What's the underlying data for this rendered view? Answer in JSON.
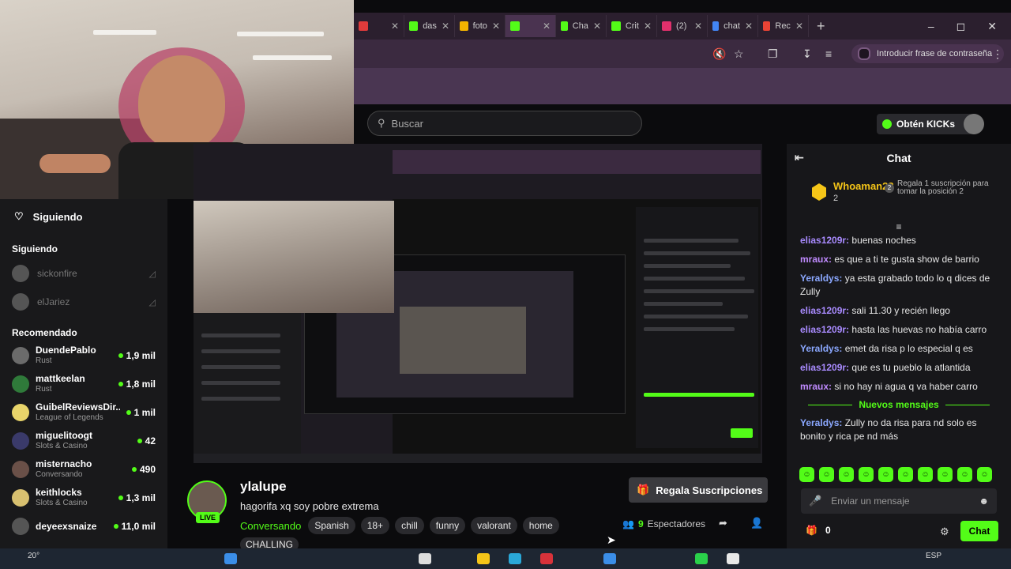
{
  "browser": {
    "tabs": [
      {
        "label": "",
        "color": "#e03b3b"
      },
      {
        "label": "das",
        "color": "#53fc18"
      },
      {
        "label": "foto",
        "color": "#f4b400"
      },
      {
        "label": "",
        "color": "#53fc18",
        "active": true
      },
      {
        "label": "Cha",
        "color": "#53fc18"
      },
      {
        "label": "Crit",
        "color": "#53fc18"
      },
      {
        "label": "(2)",
        "color": "#e1306c"
      },
      {
        "label": "chat",
        "color": "#4285f4"
      },
      {
        "label": "Rec",
        "color": "#ea4335"
      }
    ],
    "new_tab": "+",
    "password_pill": "Introducir frase de contraseña"
  },
  "header": {
    "search_placeholder": "Buscar",
    "kicks_label": "Obtén KICKs"
  },
  "sidebar": {
    "following_title": "Siguiendo",
    "following_section": "Siguiendo",
    "following": [
      {
        "name": "sickonfire"
      },
      {
        "name": "elJariez"
      }
    ],
    "recommended_section": "Recomendado",
    "recommended": [
      {
        "name": "DuendePablo",
        "category": "Rust",
        "viewers": "1,9 mil",
        "color": "#6b6b6b"
      },
      {
        "name": "mattkeelan",
        "category": "Rust",
        "viewers": "1,8 mil",
        "color": "#2f7a3a"
      },
      {
        "name": "GuibelReviewsDir...",
        "category": "League of Legends",
        "viewers": "1 mil",
        "color": "#e8d46a"
      },
      {
        "name": "miguelitoogt",
        "category": "Slots & Casino",
        "viewers": "42",
        "color": "#3a3a6a"
      },
      {
        "name": "misternacho",
        "category": "Conversando",
        "viewers": "490",
        "color": "#6a5048"
      },
      {
        "name": "keithlocks",
        "category": "Slots & Casino",
        "viewers": "1,3 mil",
        "color": "#d8c070"
      },
      {
        "name": "deyeexsnaize",
        "category": "",
        "viewers": "11,0 mil",
        "color": "#555"
      }
    ]
  },
  "stream": {
    "channel": "ylalupe",
    "live": "LIVE",
    "title": "hagorifa xq soy pobre extrema",
    "category": "Conversando",
    "tags": [
      "Spanish",
      "18+",
      "chill",
      "funny",
      "valorant",
      "home"
    ],
    "extra_tag": "CHALLING",
    "gift_button": "Regala Suscripciones",
    "viewers_count": "9",
    "viewers_label": "Espectadores"
  },
  "chat": {
    "title": "Chat",
    "pinned": {
      "name": "Whoaman22",
      "sub": "2",
      "message": "Regala 1 suscripción para tomar la posición 2"
    },
    "messages": [
      {
        "user": "elias1209r",
        "text": "buenas noches",
        "color": "#a98bff"
      },
      {
        "user": "mraux",
        "text": "es que a ti te gusta show de barrio",
        "color": "#c08bff"
      },
      {
        "user": "Yeraldys",
        "text": "ya esta grabado todo lo q dices de Zully",
        "color": "#8ba8ff"
      },
      {
        "user": "elias1209r",
        "text": "sali 11.30 y recién llego",
        "color": "#a98bff"
      },
      {
        "user": "elias1209r",
        "text": "hasta las huevas no había carro",
        "color": "#a98bff"
      },
      {
        "user": "Yeraldys",
        "text": "emet da risa p lo especial q es",
        "color": "#8ba8ff"
      },
      {
        "user": "elias1209r",
        "text": "que es tu pueblo la atlantida",
        "color": "#a98bff"
      },
      {
        "user": "mraux",
        "text": "si no hay ni agua q va haber carro",
        "color": "#c08bff"
      }
    ],
    "new_messages_label": "Nuevos mensajes",
    "new_messages": [
      {
        "user": "Yeraldys",
        "text": "Zully no da risa para nd solo es bonito y rica pe nd más",
        "color": "#8ba8ff"
      }
    ],
    "emote_count": 10,
    "input_placeholder": "Enviar un mensaje",
    "points": "0",
    "send_label": "Chat"
  },
  "taskbar": {
    "temperature": "20°",
    "language": "ESP"
  }
}
